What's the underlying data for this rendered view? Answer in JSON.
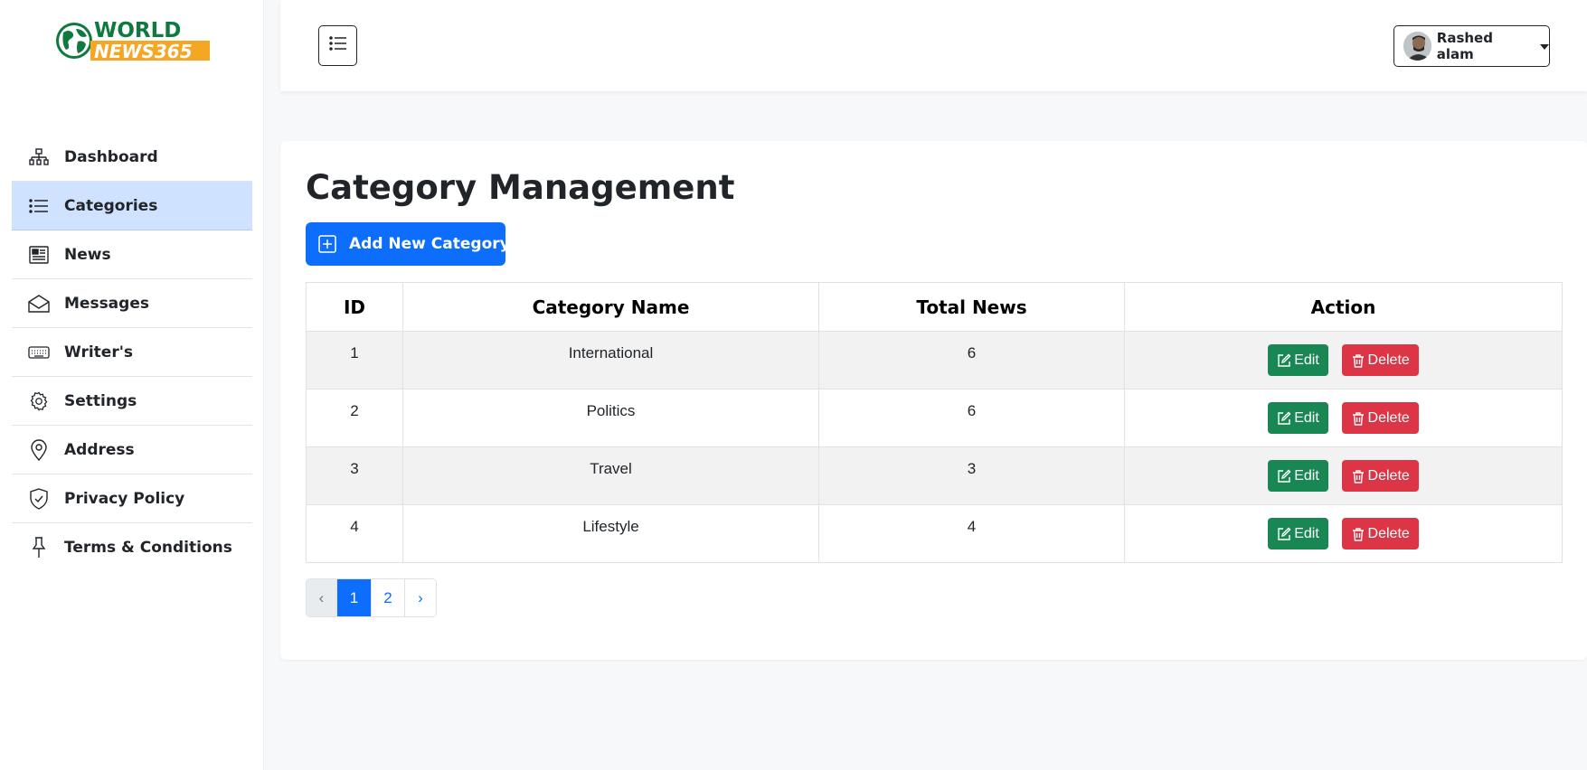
{
  "brand": {
    "logo_line1": "WORLD",
    "logo_line2": "NEWS365",
    "colors": {
      "green": "#0f7a3e",
      "orange": "#f5a623"
    }
  },
  "sidebar": {
    "items": [
      {
        "label": "Dashboard",
        "icon": "diagram-icon",
        "active": false
      },
      {
        "label": "Categories",
        "icon": "list-icon",
        "active": true
      },
      {
        "label": "News",
        "icon": "newspaper-icon",
        "active": false
      },
      {
        "label": "Messages",
        "icon": "envelope-icon",
        "active": false
      },
      {
        "label": "Writer's",
        "icon": "keyboard-icon",
        "active": false
      },
      {
        "label": "Settings",
        "icon": "gear-icon",
        "active": false
      },
      {
        "label": "Address",
        "icon": "map-pin-icon",
        "active": false
      },
      {
        "label": "Privacy Policy",
        "icon": "shield-check-icon",
        "active": false
      },
      {
        "label": "Terms & Conditions",
        "icon": "pin-icon",
        "active": false
      }
    ]
  },
  "header": {
    "menu_toggle_icon": "list-icon",
    "user": {
      "name": "Rashed alam",
      "avatar_icon": "user-avatar"
    }
  },
  "main": {
    "title": "Category Management",
    "add_button_label": "Add New Category",
    "table": {
      "columns": [
        "ID",
        "Category Name",
        "Total News",
        "Action"
      ],
      "rows": [
        {
          "id": "1",
          "name": "International",
          "total": "6"
        },
        {
          "id": "2",
          "name": "Politics",
          "total": "6"
        },
        {
          "id": "3",
          "name": "Travel",
          "total": "3"
        },
        {
          "id": "4",
          "name": "Lifestyle",
          "total": "4"
        }
      ],
      "edit_label": "Edit",
      "delete_label": "Delete"
    },
    "pagination": {
      "prev": "‹",
      "pages": [
        "1",
        "2"
      ],
      "current": "1",
      "next": "›"
    }
  },
  "colors": {
    "primary": "#0d6efd",
    "success": "#198754",
    "danger": "#dc3545",
    "active_nav": "#cfe2ff"
  }
}
